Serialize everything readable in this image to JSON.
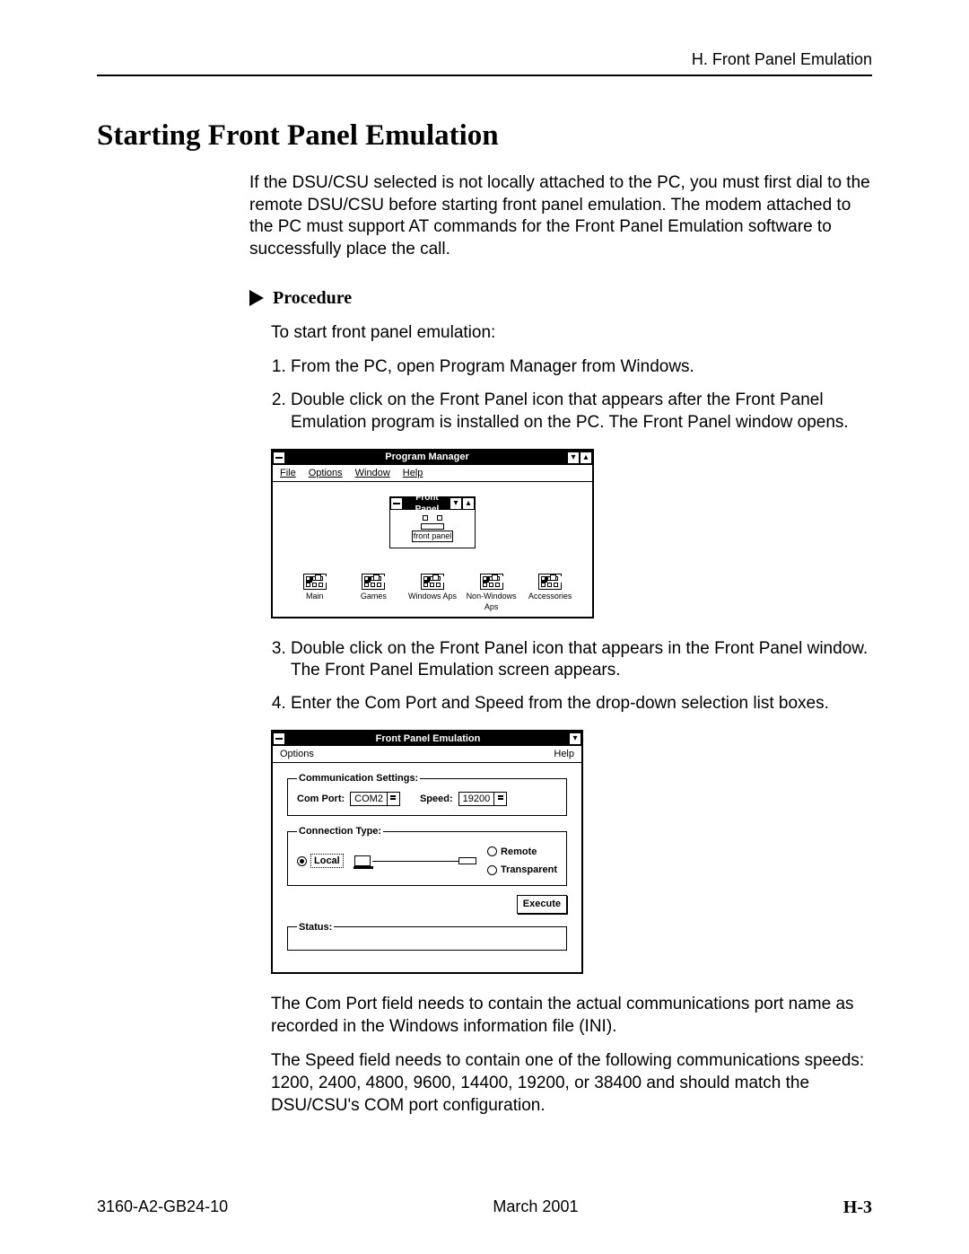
{
  "header": {
    "right": "H. Front Panel Emulation"
  },
  "title": "Starting Front Panel Emulation",
  "intro": "If the DSU/CSU selected is not locally attached to the PC, you must first dial to the remote DSU/CSU before starting front panel emulation. The modem attached to the PC must support AT commands for the Front Panel Emulation software to successfully place the call.",
  "procedure_label": "Procedure",
  "procedure_intro": "To start front panel emulation:",
  "steps": {
    "s1": "From the PC, open Program Manager from Windows.",
    "s2": "Double click on the Front Panel icon that appears after the Front Panel Emulation program is installed on the PC. The Front Panel window opens.",
    "s3": "Double click on the Front Panel icon that appears in the Front Panel window. The Front Panel Emulation screen appears.",
    "s4": "Enter the Com Port and Speed from the drop-down selection list boxes."
  },
  "pm": {
    "title": "Program Manager",
    "menu": {
      "file": "File",
      "options": "Options",
      "window": "Window",
      "help": "Help"
    },
    "fp_title": "Front Panel",
    "fp_icon_label": "front panel",
    "min_down": "▾",
    "min_up": "▴",
    "groups": {
      "g1": "Main",
      "g2": "Games",
      "g3": "Windows Aps",
      "g4": "Non-Windows Aps",
      "g5": "Accessories"
    }
  },
  "fpe": {
    "title": "Front Panel Emulation",
    "menu": {
      "options": "Options",
      "help": "Help"
    },
    "comm_legend": "Communication Settings:",
    "com_port_label": "Com Port:",
    "com_port_value": "COM2",
    "speed_label": "Speed:",
    "speed_value": "19200",
    "conn_legend": "Connection Type:",
    "local": "Local",
    "remote": "Remote",
    "transparent": "Transparent",
    "execute": "Execute",
    "status_legend": "Status:"
  },
  "notes": {
    "n1": "The Com Port field needs to contain the actual communications port name as recorded in the Windows information file (INI).",
    "n2": "The Speed field needs to contain one of the following communications speeds: 1200, 2400, 4800, 9600, 14400, 19200, or 38400 and should match the DSU/CSU's COM port configuration."
  },
  "footer": {
    "doc": "3160-A2-GB24-10",
    "date": "March 2001",
    "page": "H-3"
  }
}
